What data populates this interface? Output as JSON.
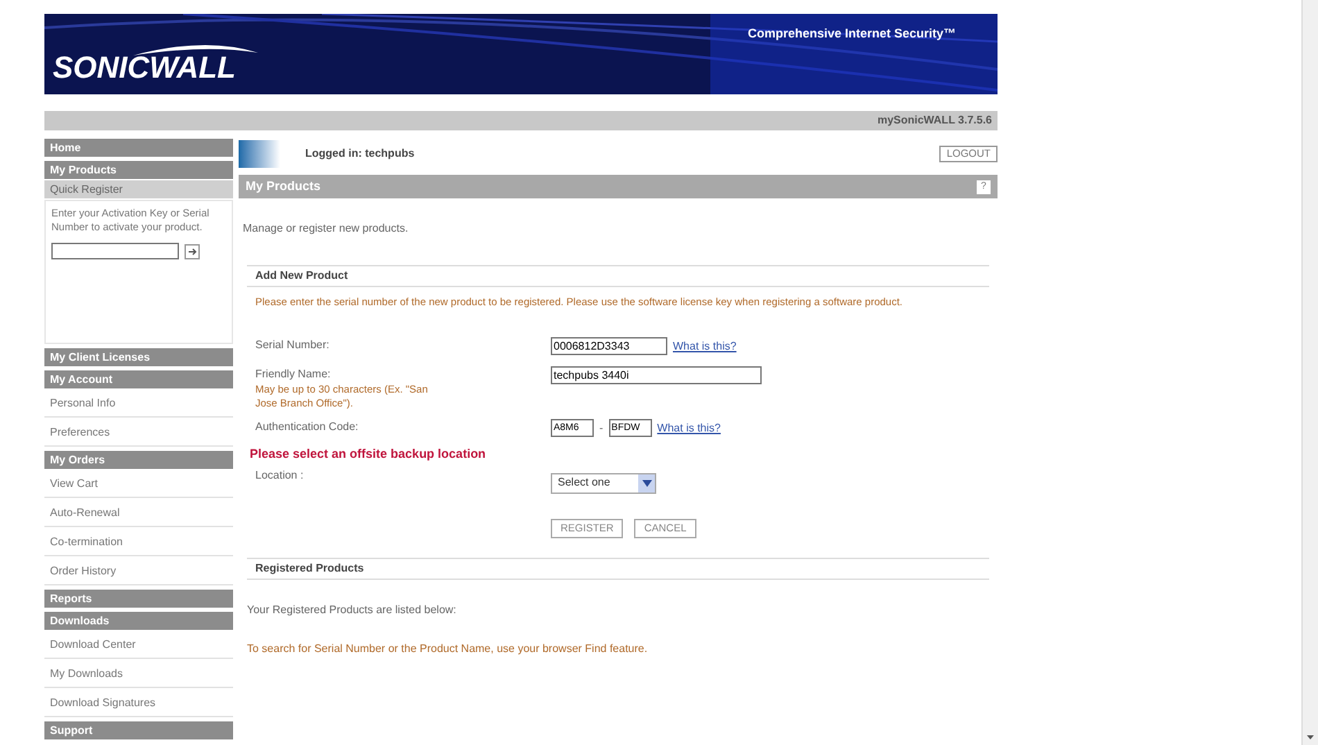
{
  "header": {
    "logo": "SONICWALL",
    "tagline": "Comprehensive Internet Security™",
    "version": "mySonicWALL 3.7.5.6"
  },
  "sidebar": {
    "items": [
      {
        "kind": "header",
        "label": "Home"
      },
      {
        "kind": "header",
        "label": "My Products"
      },
      {
        "kind": "subheader",
        "label": "Quick Register"
      },
      {
        "kind": "quick_register",
        "text": "Enter your Activation Key or Serial Number to activate your product."
      },
      {
        "kind": "header",
        "label": "My Client Licenses"
      },
      {
        "kind": "header",
        "label": "My Account"
      },
      {
        "kind": "link",
        "label": "Personal Info"
      },
      {
        "kind": "link",
        "label": "Preferences"
      },
      {
        "kind": "header",
        "label": "My Orders"
      },
      {
        "kind": "link",
        "label": "View Cart"
      },
      {
        "kind": "link",
        "label": "Auto-Renewal"
      },
      {
        "kind": "link",
        "label": "Co-termination"
      },
      {
        "kind": "link",
        "label": "Order History"
      },
      {
        "kind": "header",
        "label": "Reports"
      },
      {
        "kind": "header",
        "label": "Downloads"
      },
      {
        "kind": "link",
        "label": "Download Center"
      },
      {
        "kind": "link",
        "label": "My Downloads"
      },
      {
        "kind": "link",
        "label": "Download Signatures"
      },
      {
        "kind": "header",
        "label": "Support"
      }
    ]
  },
  "main": {
    "logged_in": "Logged in: techpubs",
    "logout": "LOGOUT",
    "title": "My Products",
    "help": "?",
    "intro": "Manage or register new products.",
    "add_section": {
      "title": "Add New Product",
      "instructions": "Please enter the serial number of the new product to be registered. Please use the software license key when registering a software product.",
      "serial": {
        "label": "Serial Number:",
        "value": "0006812D3343",
        "link": "What is this?"
      },
      "friendly": {
        "label": "Friendly Name:",
        "hint": "May be up to 30 characters (Ex. \"San Jose Branch Office\").",
        "value": "techpubs 3440i"
      },
      "auth": {
        "label": "Authentication Code:",
        "part1": "A8M6",
        "separator": "-",
        "part2": "BFDW",
        "link": "What is this?"
      },
      "warning": "Please select an offsite backup location",
      "location": {
        "label": "Location :",
        "value": "Select one"
      },
      "buttons": [
        "REGISTER",
        "CANCEL"
      ]
    },
    "registered_section": {
      "title": "Registered Products",
      "lines": [
        {
          "kind": "plain",
          "text": "Your Registered Products are listed below:"
        },
        {
          "kind": "note",
          "text": "To search for Serial Number or the Product Name, use your browser Find feature."
        }
      ]
    }
  }
}
